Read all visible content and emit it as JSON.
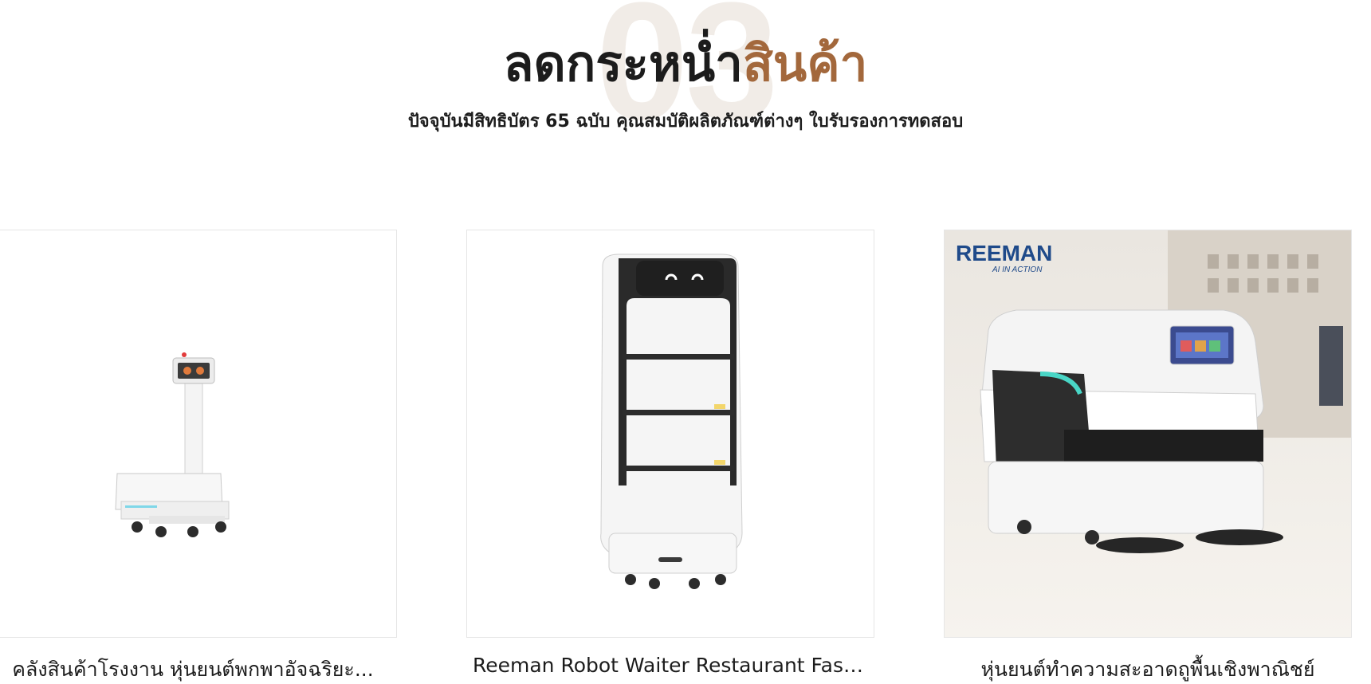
{
  "section": {
    "bg_number": "03",
    "heading_dark": "ลดกระหน่ำ",
    "heading_accent": "สินค้า",
    "subtitle": "ปัจจุบันมีสิทธิบัตร 65 ฉบับ คุณสมบัติผลิตภัณฑ์ต่างๆ ใบรับรองการทดสอบ"
  },
  "colors": {
    "accent": "#a3683c",
    "bg_number": "#f1ece7",
    "text": "#1c1c1c"
  },
  "products": [
    {
      "title": "คลังสินค้าโรงงาน หุ่นยนต์พกพาอัจฉริยะ...",
      "image": "warehouse-delivery-robot-image"
    },
    {
      "title": "Reeman Robot Waiter Restaurant Fast...",
      "image": "waiter-robot-image"
    },
    {
      "title": "หุ่นยนต์ทำความสะอาดถูพื้นเชิงพาณิชย์",
      "image": "floor-cleaning-robot-image"
    }
  ],
  "brand_logo": {
    "text": "REEMAN",
    "tagline": "AI IN ACTION"
  }
}
